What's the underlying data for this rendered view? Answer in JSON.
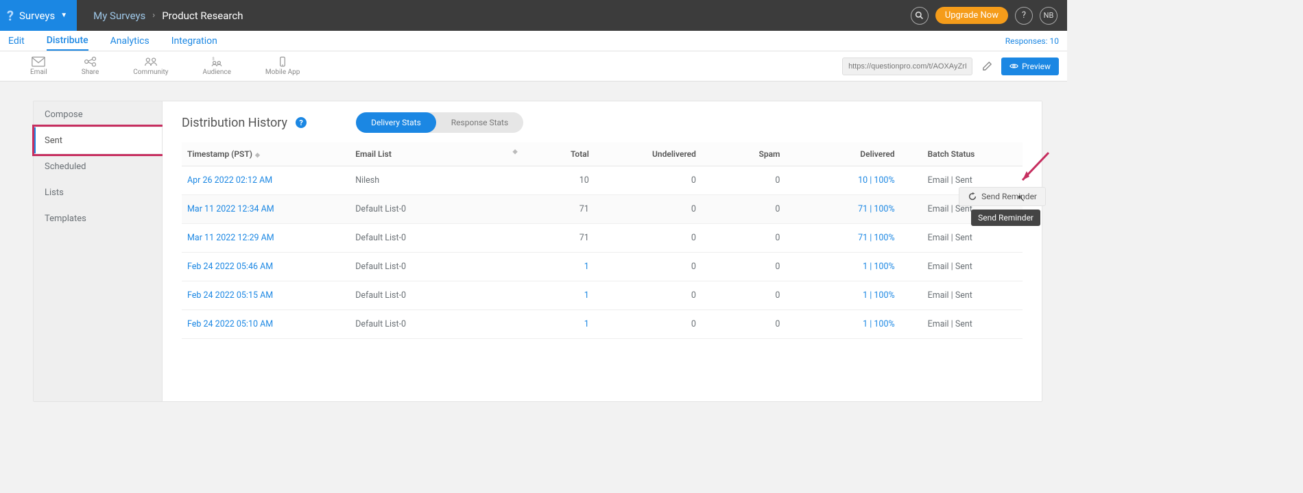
{
  "header": {
    "brand": "Surveys",
    "breadcrumb_root": "My Surveys",
    "breadcrumb_sep": "›",
    "survey_name": "Product Research",
    "upgrade_label": "Upgrade Now",
    "avatar_initials": "NB"
  },
  "main_nav": {
    "tabs": [
      {
        "label": "Edit"
      },
      {
        "label": "Distribute",
        "active": true
      },
      {
        "label": "Analytics"
      },
      {
        "label": "Integration"
      }
    ],
    "responses_label": "Responses: 10"
  },
  "toolbar": {
    "items": [
      {
        "label": "Email",
        "icon": "email-icon"
      },
      {
        "label": "Share",
        "icon": "share-icon"
      },
      {
        "label": "Community",
        "icon": "community-icon"
      },
      {
        "label": "Audience",
        "icon": "audience-icon"
      },
      {
        "label": "Mobile App",
        "icon": "mobile-icon"
      }
    ],
    "url": "https://questionpro.com/t/AOXAyZrIjI",
    "preview_label": "Preview"
  },
  "sidebar": {
    "items": [
      {
        "label": "Compose"
      },
      {
        "label": "Sent",
        "active": true
      },
      {
        "label": "Scheduled"
      },
      {
        "label": "Lists"
      },
      {
        "label": "Templates"
      }
    ]
  },
  "content": {
    "title": "Distribution History",
    "pill_a": "Delivery Stats",
    "pill_b": "Response Stats",
    "columns": {
      "timestamp": "Timestamp (PST)",
      "email_list": "Email List",
      "total": "Total",
      "undelivered": "Undelivered",
      "spam": "Spam",
      "delivered": "Delivered",
      "batch_status": "Batch Status"
    },
    "rows": [
      {
        "ts": "Apr 26 2022 02:12 AM",
        "list": "Nilesh",
        "total": "10",
        "undeliv": "0",
        "spam": "0",
        "deliv": "10 | 100%",
        "status": "Email | Sent"
      },
      {
        "ts": "Mar 11 2022 12:34 AM",
        "list": "Default List-0",
        "total": "71",
        "undeliv": "0",
        "spam": "0",
        "deliv": "71 | 100%",
        "status": "Email | Sent",
        "hovered": true
      },
      {
        "ts": "Mar 11 2022 12:29 AM",
        "list": "Default List-0",
        "total": "71",
        "undeliv": "0",
        "spam": "0",
        "deliv": "71 | 100%",
        "status": "Email | Sent"
      },
      {
        "ts": "Feb 24 2022 05:46 AM",
        "list": "Default List-0",
        "total": "1",
        "undeliv": "0",
        "spam": "0",
        "deliv": "1 | 100%",
        "status": "Email | Sent"
      },
      {
        "ts": "Feb 24 2022 05:15 AM",
        "list": "Default List-0",
        "total": "1",
        "undeliv": "0",
        "spam": "0",
        "deliv": "1 | 100%",
        "status": "Email | Sent"
      },
      {
        "ts": "Feb 24 2022 05:10 AM",
        "list": "Default List-0",
        "total": "1",
        "undeliv": "0",
        "spam": "0",
        "deliv": "1 | 100%",
        "status": "Email | Sent"
      }
    ],
    "send_reminder_label": "Send Reminder",
    "tooltip_text": "Send Reminder"
  }
}
